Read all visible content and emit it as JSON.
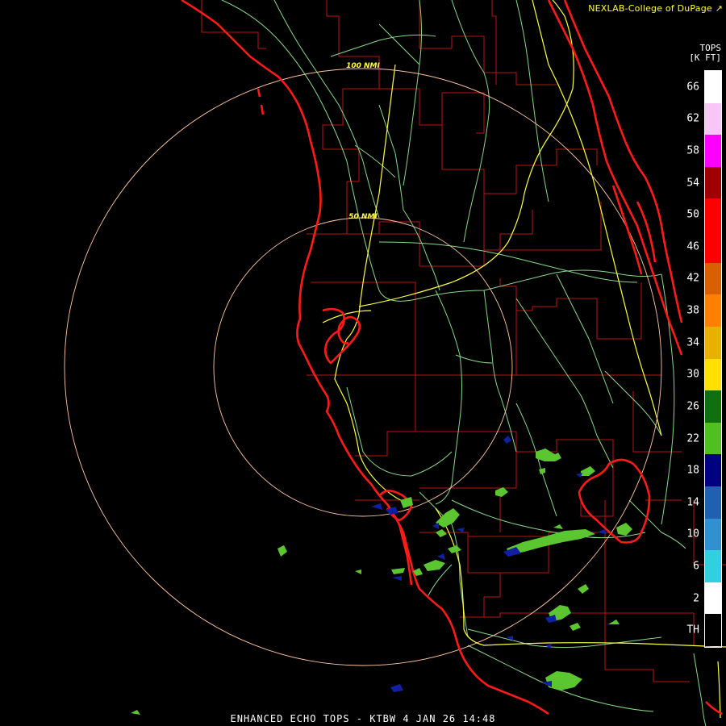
{
  "credit": "NEXLAB-College of DuPage",
  "credit_icon": "arrow-logo-icon",
  "legend": {
    "title_line1": "TOPS",
    "title_line2": "[K FT]",
    "labels": [
      "66",
      "62",
      "58",
      "54",
      "50",
      "46",
      "42",
      "38",
      "34",
      "30",
      "26",
      "22",
      "18",
      "14",
      "10",
      "6",
      "2",
      "TH"
    ],
    "colors": [
      "#ffffff",
      "#f7c6f7",
      "#ff00ff",
      "#a00000",
      "#ff0000",
      "#ff0000",
      "#d86000",
      "#ff8000",
      "#e8b000",
      "#ffe000",
      "#107010",
      "#50c020",
      "#000080",
      "#2060b0",
      "#3090d0",
      "#30d0e0",
      "#ffffff",
      "#000000"
    ]
  },
  "range_rings": [
    {
      "label": "50 NMI",
      "nmi": 50
    },
    {
      "label": "100 NMI",
      "nmi": 100
    }
  ],
  "footer": "ENHANCED ECHO TOPS - KTBW 4 JAN 26 14:48",
  "colors": {
    "coast": "#ff1a1a",
    "counties": "#c01818",
    "highways": "#ffff40",
    "roads": "#8ad88a",
    "ring": "#ffc8a0",
    "echo_green": "#5cc630",
    "echo_blue": "#1020a0"
  }
}
